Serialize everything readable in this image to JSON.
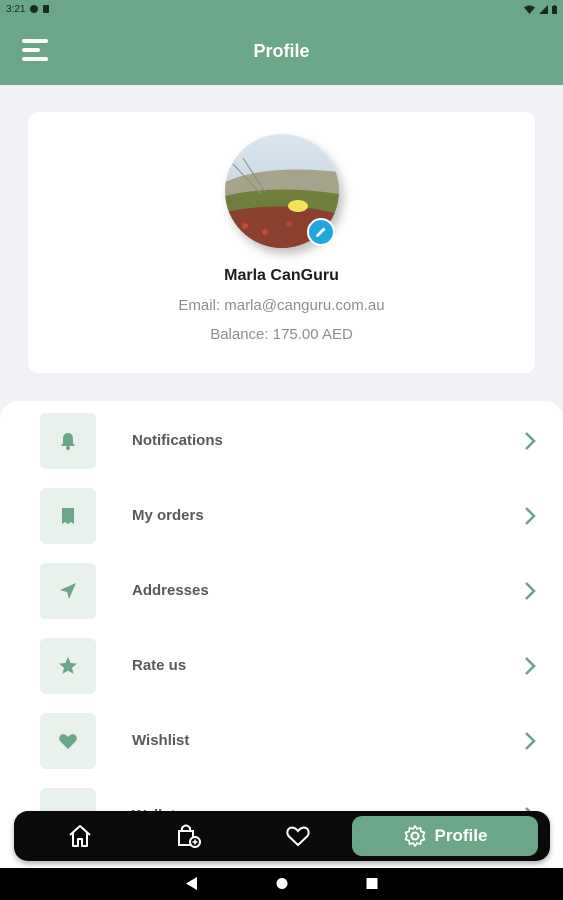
{
  "status_bar": {
    "time": "3:21"
  },
  "app_bar": {
    "title": "Profile"
  },
  "profile": {
    "name": "Marla CanGuru",
    "email": "Email: marla@canguru.com.au",
    "balance": "Balance: 175.00 AED"
  },
  "menu": {
    "items": [
      {
        "label": "Notifications",
        "icon": "bell-icon"
      },
      {
        "label": "My orders",
        "icon": "receipt-icon"
      },
      {
        "label": "Addresses",
        "icon": "location-arrow-icon"
      },
      {
        "label": "Rate us",
        "icon": "star-icon"
      },
      {
        "label": "Wishlist",
        "icon": "heart-icon"
      },
      {
        "label": "Wallet",
        "icon": "wallet-icon"
      }
    ]
  },
  "bottom_nav": {
    "items": [
      "home-icon",
      "shopping-bag-icon",
      "heart-icon",
      "gear-icon"
    ],
    "active_label": "Profile"
  },
  "colors": {
    "accent": "#6aa687",
    "icon_tile": "#e8f1ec",
    "edit_badge": "#21a7e0",
    "nav_bar": "#0a0a0a"
  }
}
